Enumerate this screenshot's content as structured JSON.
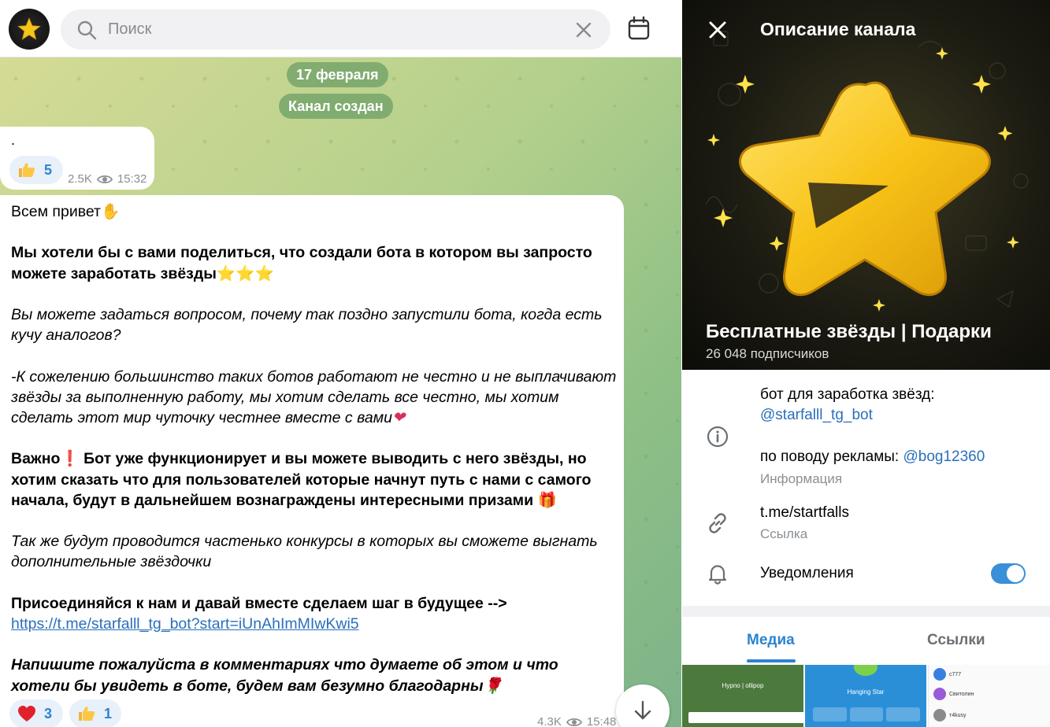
{
  "search": {
    "placeholder": "Поиск"
  },
  "chat": {
    "date_pill": "17 февраля",
    "service_pill": "Канал создан",
    "post1": {
      "text": ".",
      "reaction_count": "5",
      "views": "2.5K",
      "time": "15:32"
    },
    "post2": {
      "line_greeting": "Всем привет",
      "para1": "Мы хотели бы с вами поделиться, что создали бота в котором вы запросто можете заработать звёзды",
      "para2": "Вы можете задаться вопросом, почему так поздно запустили бота, когда есть кучу аналогов?",
      "para3": "-К сожелению большинство таких ботов работают не честно и не выплачивают звёзды за выполненную работу, мы хотим сделать все честно, мы хотим сделать этот мир чуточку честнее вместе с вами",
      "para4_a": "Важно",
      "para4_b": " Бот уже функционирует и вы можете выводить с него звёзды, но хотим сказать что для пользователей которые начнут путь с нами с самого начала, будут в дальнейшем вознаграждены интересными призами ",
      "para5": "Так же будут проводится частенько конкурсы в которых вы сможете выгнать дополнительные звёздочки",
      "para6": "Присоединяйся к нам и давай вместе сделаем шаг в будущее -->",
      "link": "https://t.me/starfalll_tg_bot?start=iUnAhImMIwKwi5",
      "para7": "Напишите пожалуйста в комментариях что думаете об этом и что хотели бы увидеть в боте, будем вам безумно благодарны",
      "reaction_heart_count": "3",
      "reaction_like_count": "1",
      "views": "4.3K",
      "time": "15:48"
    }
  },
  "channel": {
    "header_title": "Описание канала",
    "name": "Бесплатные звёзды | Подарки",
    "subscribers": "26 048 подписчиков",
    "desc_line1": "бот для заработка звёзд:",
    "desc_bot": "@starfalll_tg_bot",
    "desc_ads_label": "по поводу рекламы: ",
    "desc_ads_handle": "@bog12360",
    "desc_caption": "Информация",
    "link": "t.me/startfalls",
    "link_caption": "Ссылка",
    "notifications": "Уведомления",
    "notifications_on": true,
    "tabs": [
      "Медиа",
      "Ссылки"
    ],
    "media": [
      {
        "label": "Hypno | ollipop"
      },
      {
        "label": "Hanging Star"
      },
      {
        "rows": [
          "c777",
          "Свитолин",
          "т4kusy"
        ]
      }
    ]
  },
  "colors": {
    "accent": "#2a84cf",
    "link": "#2a6fbb",
    "chat_bg_start": "#d8dc96",
    "chat_bg_end": "#7eb38a",
    "star": "#f5c518"
  },
  "icons": [
    "star-icon",
    "search-icon",
    "clear-icon",
    "calendar-icon",
    "thumbs-up-icon",
    "heart-icon",
    "eye-icon",
    "arrow-down-icon",
    "close-icon",
    "info-icon",
    "link-icon",
    "bell-icon"
  ]
}
